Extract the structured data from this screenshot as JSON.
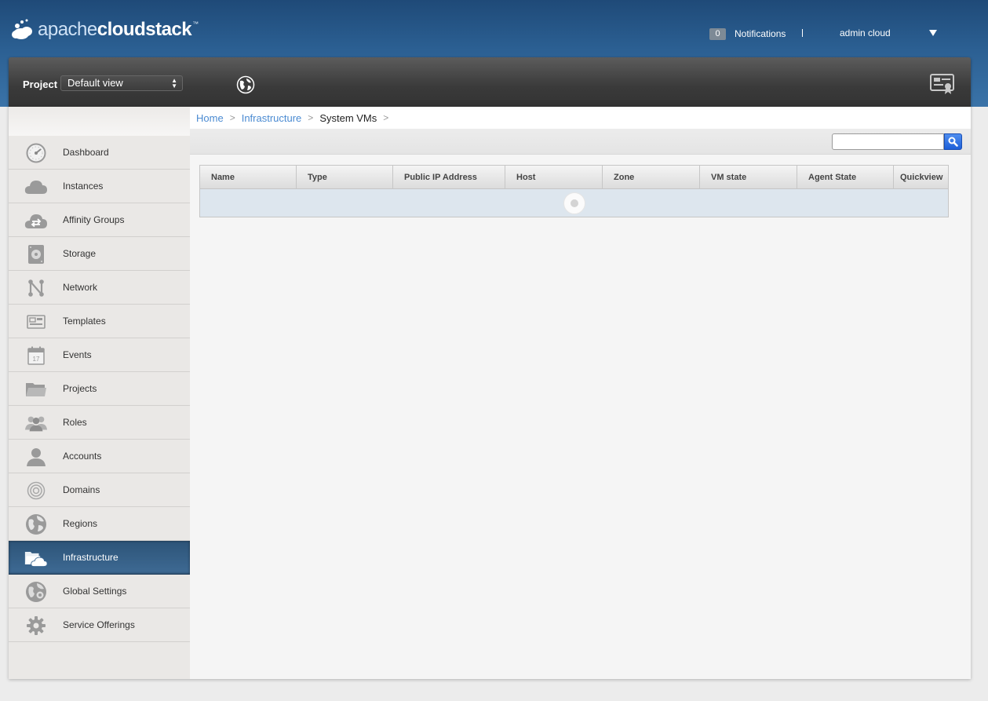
{
  "header": {
    "logo": {
      "light": "apache",
      "bold": "cloudstack",
      "tm": "™"
    },
    "notifications": {
      "count": "0",
      "label": "Notifications"
    },
    "separator": "|",
    "user": "admin cloud"
  },
  "project_bar": {
    "label": "Project",
    "selected": "Default view",
    "arrows": "▲\n▼"
  },
  "sidebar": {
    "items": [
      {
        "label": "Dashboard",
        "icon": "dashboard-icon"
      },
      {
        "label": "Instances",
        "icon": "cloud-icon"
      },
      {
        "label": "Affinity Groups",
        "icon": "affinity-cloud-icon"
      },
      {
        "label": "Storage",
        "icon": "storage-disk-icon"
      },
      {
        "label": "Network",
        "icon": "network-icon"
      },
      {
        "label": "Templates",
        "icon": "templates-icon"
      },
      {
        "label": "Events",
        "icon": "calendar-icon"
      },
      {
        "label": "Projects",
        "icon": "folder-icon"
      },
      {
        "label": "Roles",
        "icon": "roles-icon"
      },
      {
        "label": "Accounts",
        "icon": "user-icon"
      },
      {
        "label": "Domains",
        "icon": "domains-target-icon"
      },
      {
        "label": "Regions",
        "icon": "globe-icon"
      },
      {
        "label": "Infrastructure",
        "icon": "infrastructure-icon",
        "active": true
      },
      {
        "label": "Global Settings",
        "icon": "global-settings-icon"
      },
      {
        "label": "Service Offerings",
        "icon": "gear-icon"
      }
    ],
    "calendar_day": "17"
  },
  "breadcrumb": {
    "home": "Home",
    "infrastructure": "Infrastructure",
    "current": "System VMs",
    "sep": ">"
  },
  "search": {
    "value": "",
    "placeholder": ""
  },
  "table": {
    "columns": [
      "Name",
      "Type",
      "Public IP Address",
      "Host",
      "Zone",
      "VM state",
      "Agent State",
      "Quickview"
    ],
    "rows": []
  },
  "colors": {
    "header_blue": "#2b5f92",
    "active_nav": "#3e6a94",
    "link": "#4b8bd2",
    "search_button": "#1d5fd8"
  }
}
